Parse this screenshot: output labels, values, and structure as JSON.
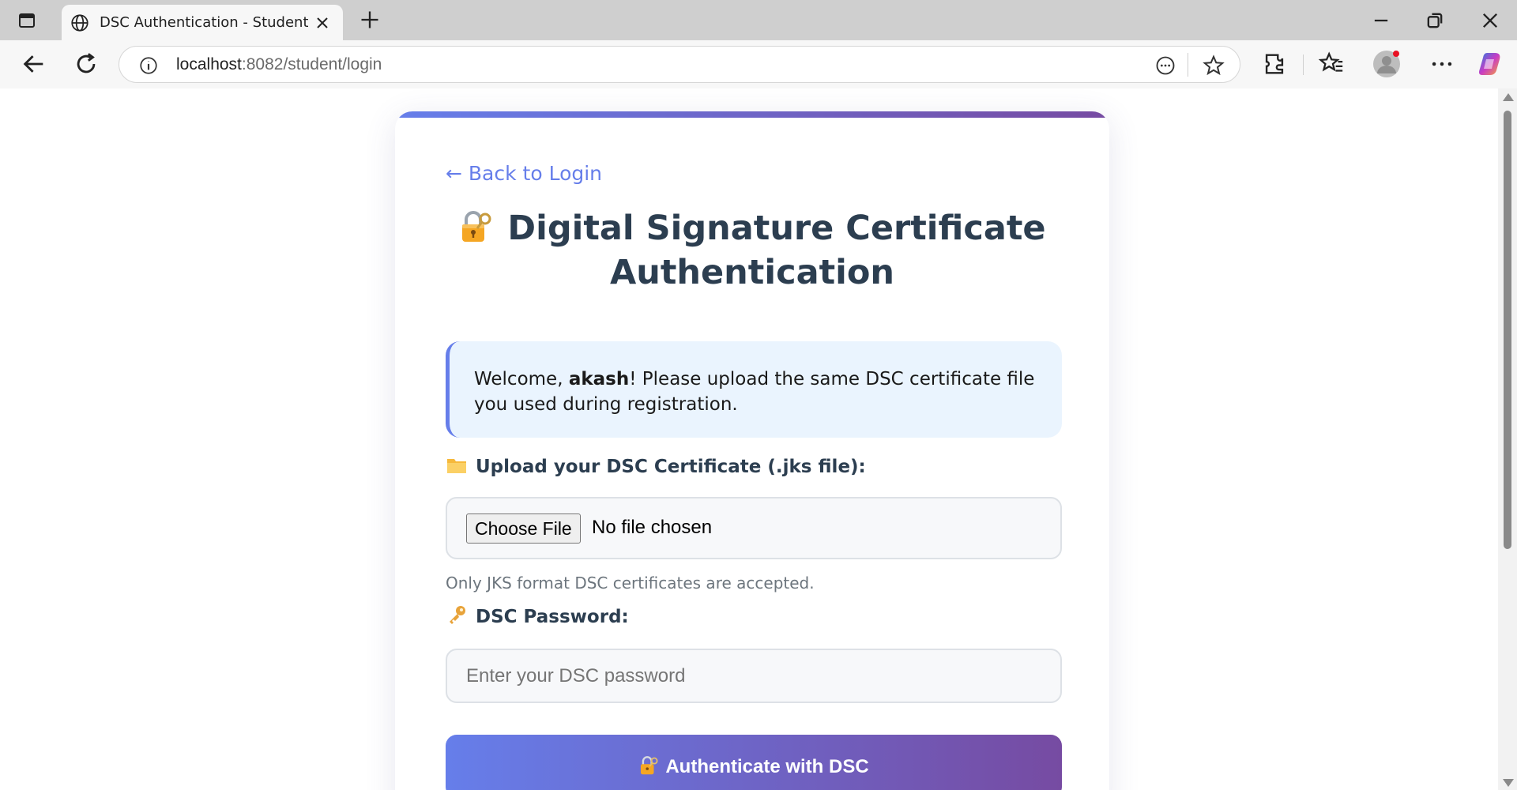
{
  "browser": {
    "tab_title": "DSC Authentication - Student Portal",
    "url_host": "localhost",
    "url_path": ":8082/student/login",
    "icons": [
      "tab-actions-icon",
      "globe-icon",
      "close-icon",
      "new-tab-icon",
      "minimize-icon",
      "restore-icon",
      "window-close-icon",
      "back-icon",
      "refresh-icon",
      "info-icon",
      "read-aloud-icon",
      "favorite-star-icon",
      "extensions-icon",
      "favorites-icon",
      "profile-icon",
      "more-icon",
      "copilot-icon"
    ]
  },
  "page": {
    "back_link": "← Back to Login",
    "title_line1": "Digital Signature Certificate",
    "title_line2": "Authentication",
    "notice_prefix": "Welcome, ",
    "notice_user": "akash",
    "notice_suffix": "! Please upload the same DSC certificate file you used during registration.",
    "upload_label": "Upload your DSC Certificate (.jks file):",
    "choose_file": "Choose File",
    "no_file": "No file chosen",
    "upload_hint": "Only JKS format DSC certificates are accepted.",
    "password_label": "DSC Password:",
    "password_placeholder": "Enter your DSC password",
    "submit_label": "Authenticate with DSC"
  },
  "colors": {
    "accent_start": "#667eea",
    "accent_end": "#764ba2",
    "heading": "#2c3e50",
    "notice_bg": "#eaf4fe"
  }
}
